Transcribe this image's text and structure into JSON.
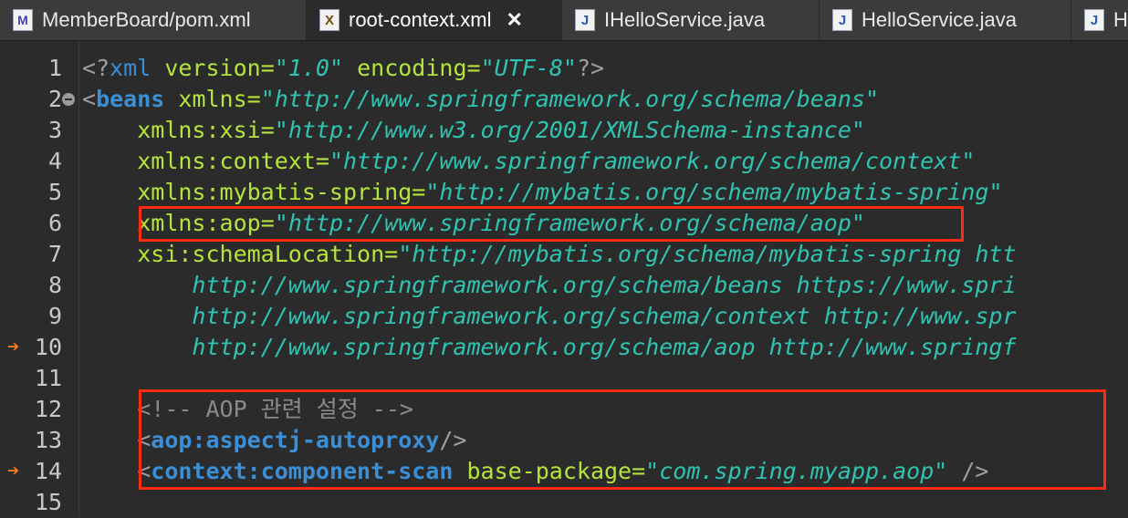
{
  "tabs": [
    {
      "label": "MemberBoard/pom.xml",
      "icon": "maven-pom-icon",
      "active": false
    },
    {
      "label": "root-context.xml",
      "icon": "xml-file-icon",
      "active": true
    },
    {
      "label": "IHelloService.java",
      "icon": "java-file-icon",
      "active": false
    },
    {
      "label": "HelloService.java",
      "icon": "java-file-icon",
      "active": false
    },
    {
      "label": "H",
      "icon": "java-file-icon",
      "active": false
    }
  ],
  "close_glyph": "✕",
  "line_numbers": [
    "1",
    "2",
    "3",
    "4",
    "5",
    "6",
    "7",
    "8",
    "9",
    "10",
    "11",
    "12",
    "13",
    "14",
    "15"
  ],
  "code": {
    "l1": {
      "open": "<?",
      "tag": "xml",
      "a1": "version",
      "v1": "1.0",
      "a2": "encoding",
      "v2": "UTF-8",
      "close": "?>"
    },
    "l2": {
      "open": "<",
      "tag": "beans",
      "attr": "xmlns",
      "val": "http://www.springframework.org/schema/beans"
    },
    "l3": {
      "attr": "xmlns:xsi",
      "val": "http://www.w3.org/2001/XMLSchema-instance"
    },
    "l4": {
      "attr": "xmlns:context",
      "val": "http://www.springframework.org/schema/context"
    },
    "l5": {
      "attr": "xmlns:mybatis-spring",
      "val": "http://mybatis.org/schema/mybatis-spring"
    },
    "l6": {
      "attr": "xmlns:aop",
      "val": "http://www.springframework.org/schema/aop"
    },
    "l7": {
      "attr": "xsi:schemaLocation",
      "val": "http://mybatis.org/schema/mybatis-spring htt"
    },
    "l8": "http://www.springframework.org/schema/beans https://www.spri",
    "l9": "http://www.springframework.org/schema/context http://www.spr",
    "l10": "http://www.springframework.org/schema/aop http://www.springf",
    "l12": "<!-- AOP 관련 설정 -->",
    "l13": {
      "open": "<",
      "tag": "aop:aspectj-autoproxy",
      "close": "/>"
    },
    "l14": {
      "open": "<",
      "tag": "context:component-scan",
      "attr": "base-package",
      "val": "com.spring.myapp.aop",
      "close": " />"
    }
  },
  "colors": {
    "background": "#2b2b2b",
    "highlight_box": "#ff2a12",
    "tag": "#3a8fd6",
    "attribute": "#b5e53a",
    "string": "#2fc4b2",
    "comment": "#8a8a8a"
  }
}
